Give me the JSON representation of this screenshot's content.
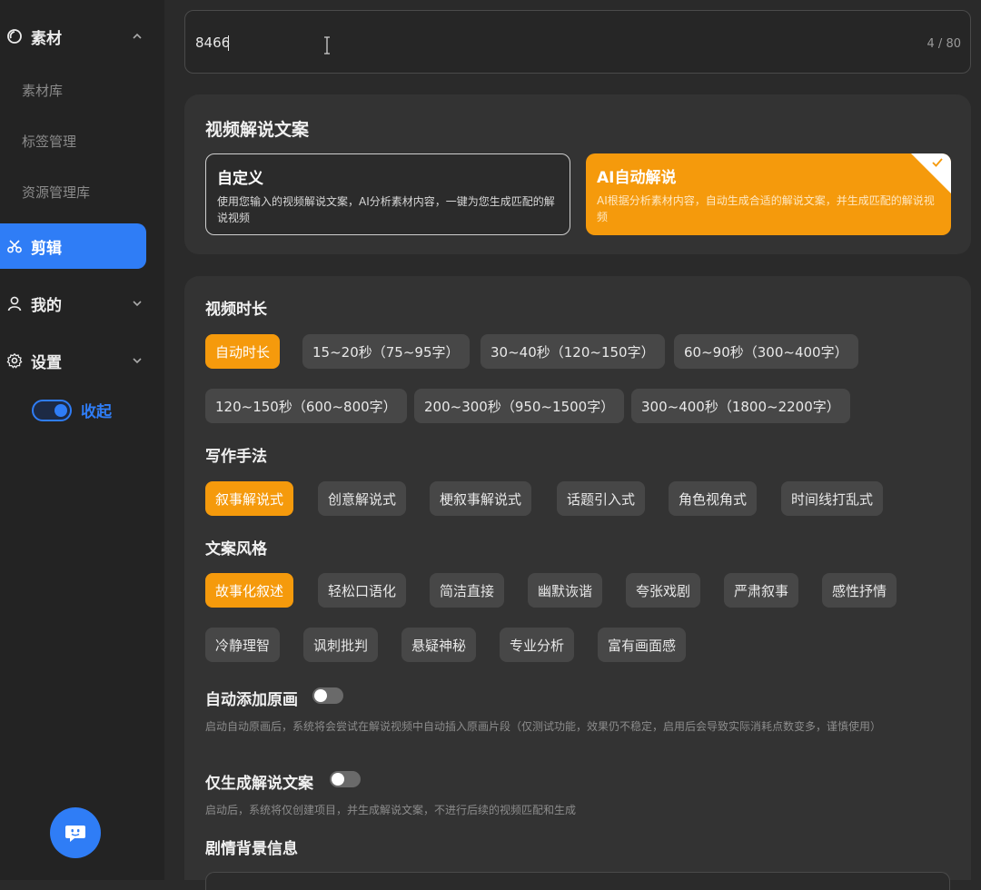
{
  "sidebar": {
    "materials": {
      "label": "素材",
      "items": [
        "素材库",
        "标签管理",
        "资源管理库"
      ]
    },
    "edit": {
      "label": "剪辑"
    },
    "mine": {
      "label": "我的"
    },
    "settings": {
      "label": "设置"
    },
    "collapse_label": "收起"
  },
  "title_input": {
    "value": "8466",
    "count": "4 / 80"
  },
  "script_panel": {
    "title": "视频解说文案",
    "custom": {
      "title": "自定义",
      "desc": "使用您输入的视频解说文案，AI分析素材内容，一键为您生成匹配的解说视频"
    },
    "ai": {
      "title": "AI自动解说",
      "desc": "AI根据分析素材内容，自动生成合适的解说文案，并生成匹配的解说视频"
    }
  },
  "options": {
    "duration": {
      "label": "视频时长",
      "chips": [
        "自动时长",
        "15~20秒（75~95字）",
        "30~40秒（120~150字）",
        "60~90秒（300~400字）",
        "120~150秒（600~800字）",
        "200~300秒（950~1500字）",
        "300~400秒（1800~2200字）"
      ]
    },
    "technique": {
      "label": "写作手法",
      "chips": [
        "叙事解说式",
        "创意解说式",
        "梗叙事解说式",
        "话题引入式",
        "角色视角式",
        "时间线打乱式"
      ]
    },
    "style": {
      "label": "文案风格",
      "chips": [
        "故事化叙述",
        "轻松口语化",
        "简洁直接",
        "幽默诙谐",
        "夸张戏剧",
        "严肃叙事",
        "感性抒情",
        "冷静理智",
        "讽刺批判",
        "悬疑神秘",
        "专业分析",
        "富有画面感"
      ]
    },
    "auto_original": {
      "label": "自动添加原画",
      "hint": "启动自动原画后，系统将会尝试在解说视频中自动插入原画片段（仅测试功能，效果仍不稳定，启用后会导致实际消耗点数变多，谨慎使用）"
    },
    "only_script": {
      "label": "仅生成解说文案",
      "hint": "启动后，系统将仅创建项目，并生成解说文案，不进行后续的视频匹配和生成"
    },
    "background": {
      "label": "剧情背景信息"
    }
  },
  "colors": {
    "accent_orange": "#f59a0c",
    "accent_blue": "#2f7df6"
  }
}
